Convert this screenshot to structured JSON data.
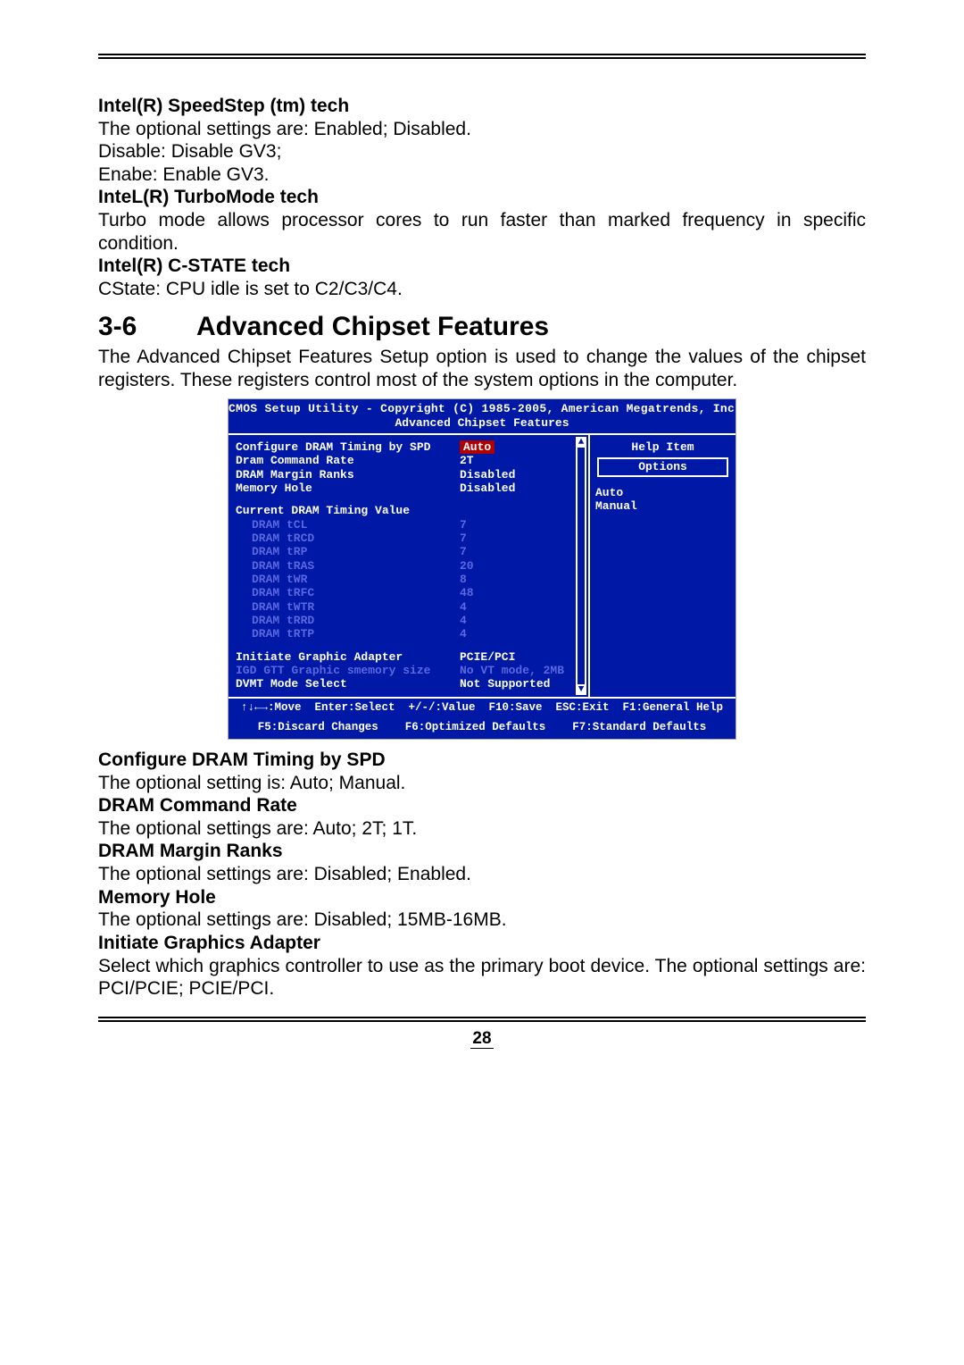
{
  "doc": {
    "speedstep_h": "Intel(R) SpeedStep (tm) tech",
    "speedstep_p1": "The optional settings are: Enabled; Disabled.",
    "speedstep_p2": "Disable: Disable GV3;",
    "speedstep_p3": "Enabe: Enable GV3.",
    "turbo_h": "InteL(R) TurboMode tech",
    "turbo_p": "Turbo mode allows processor cores to run faster than marked frequency in specific condition.",
    "cstate_h": "Intel(R) C-STATE tech",
    "cstate_p": "CState: CPU idle is set to C2/C3/C4.",
    "section_num": "3-6",
    "section_title": "Advanced Chipset Features",
    "section_intro": "The Advanced Chipset Features Setup option is used to change the values of the chipset registers. These registers control most of the system options in the computer.",
    "cfg_dram_h": "Configure DRAM Timing by SPD",
    "cfg_dram_p": "The optional setting is: Auto; Manual.",
    "cmd_rate_h": "DRAM Command Rate",
    "cmd_rate_p": "The optional settings are: Auto; 2T; 1T.",
    "margin_h": "DRAM Margin Ranks",
    "margin_p": "The optional settings are: Disabled; Enabled.",
    "memhole_h": "Memory Hole",
    "memhole_p": "The optional settings are: Disabled; 15MB-16MB.",
    "iga_h": "Initiate Graphics Adapter",
    "iga_p": "Select which graphics controller to use as the primary boot device. The optional settings are: PCI/PCIE; PCIE/PCI.",
    "page_number": "28"
  },
  "bios": {
    "title_line1": "CMOS Setup Utility - Copyright (C) 1985-2005, American Megatrends, Inc.",
    "title_line2": "Advanced Chipset Features",
    "rows": {
      "r0": {
        "label": "Configure DRAM Timing by SPD",
        "val": "Auto",
        "selected": true
      },
      "r1": {
        "label": "Dram Command Rate",
        "val": "2T"
      },
      "r2": {
        "label": "DRAM Margin Ranks",
        "val": "Disabled"
      },
      "r3": {
        "label": "Memory Hole",
        "val": "Disabled"
      },
      "group_header": "Current DRAM Timing Value",
      "t0": {
        "label": "DRAM tCL",
        "val": "7"
      },
      "t1": {
        "label": "DRAM tRCD",
        "val": "7"
      },
      "t2": {
        "label": "DRAM tRP",
        "val": "7"
      },
      "t3": {
        "label": "DRAM tRAS",
        "val": "20"
      },
      "t4": {
        "label": "DRAM tWR",
        "val": "8"
      },
      "t5": {
        "label": "DRAM tRFC",
        "val": "48"
      },
      "t6": {
        "label": "DRAM tWTR",
        "val": "4"
      },
      "t7": {
        "label": "DRAM tRRD",
        "val": "4"
      },
      "t8": {
        "label": "DRAM tRTP",
        "val": "4"
      },
      "b0": {
        "label": "Initiate Graphic Adapter",
        "val": "PCIE/PCI"
      },
      "b1": {
        "label": "IGD GTT Graphic smemory size",
        "val": "No VT mode, 2MB"
      },
      "b2": {
        "label": "DVMT Mode Select",
        "val": "Not Supported"
      }
    },
    "help": {
      "title": "Help Item",
      "options_label": "Options",
      "opt1": "Auto",
      "opt2": "Manual"
    },
    "footer_l1": "↑↓←→:Move  Enter:Select  +/-/:Value  F10:Save  ESC:Exit  F1:General Help",
    "footer_l2": "F5:Discard Changes    F6:Optimized Defaults    F7:Standard Defaults"
  }
}
